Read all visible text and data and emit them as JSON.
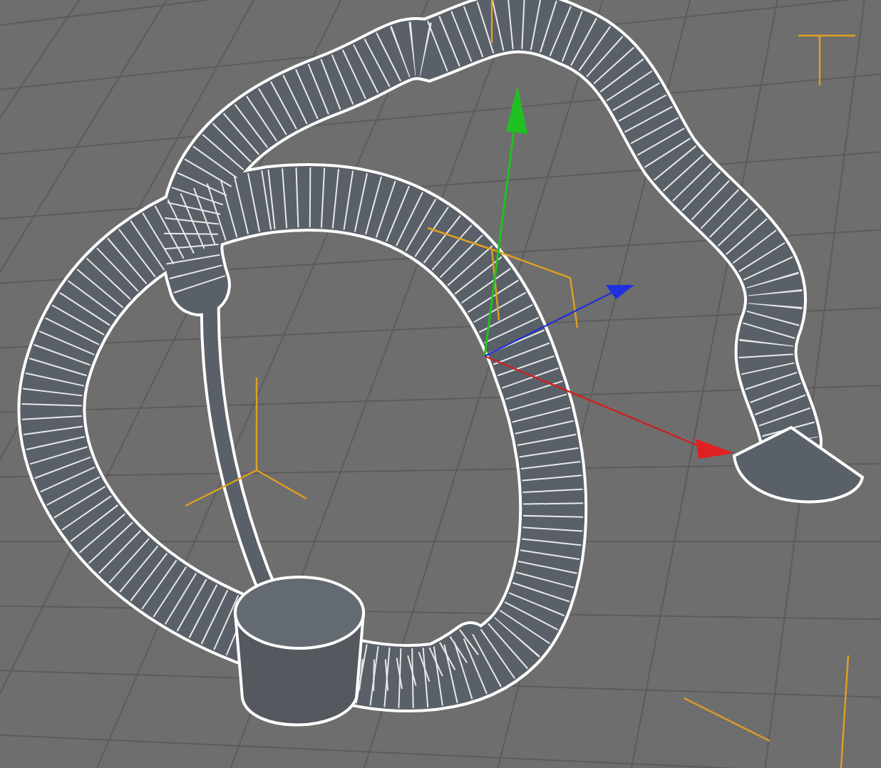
{
  "viewport": {
    "show_grid": true,
    "show_axis_gizmo": true,
    "show_bounding_box": true
  }
}
